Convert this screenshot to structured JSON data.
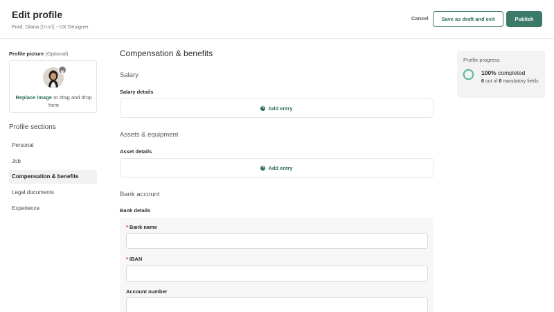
{
  "header": {
    "title": "Edit profile",
    "subtitle_name": "Ford, Diana",
    "subtitle_status": "[Draft]",
    "subtitle_role": "- UX Designer",
    "cancel_label": "Cancel",
    "draft_label": "Save as draft and exit",
    "publish_label": "Publish"
  },
  "profile_picture": {
    "label": "Profile picture",
    "optional": "(Optional)",
    "replace_link": "Replace image",
    "instructions": "or drag and drop here"
  },
  "sections": {
    "title": "Profile sections",
    "items": [
      "Personal",
      "Job",
      "Compensation & benefits",
      "Legal documents",
      "Experience"
    ],
    "active_index": 2
  },
  "main": {
    "title": "Compensation & benefits",
    "salary": {
      "heading": "Salary",
      "sub_label": "Salary details",
      "add_label": "Add entry"
    },
    "assets": {
      "heading": "Assets & equipment",
      "sub_label": "Asset details",
      "add_label": "Add entry"
    },
    "bank": {
      "heading": "Bank account",
      "sub_label": "Bank details",
      "fields": [
        {
          "label": "Bank name",
          "required": true,
          "value": ""
        },
        {
          "label": "IBAN",
          "required": true,
          "value": ""
        },
        {
          "label": "Account number",
          "required": false,
          "value": ""
        }
      ]
    }
  },
  "progress": {
    "title": "Profile progress",
    "percent": "100%",
    "completed_word": "completed",
    "done": "6",
    "out_of_text": "out of",
    "total": "6",
    "mandatory_text": "mandatory fields",
    "fraction": 1.0,
    "ring_color": "#5cb897"
  },
  "colors": {
    "accent": "#3b7a69",
    "required": "#c0392b"
  }
}
